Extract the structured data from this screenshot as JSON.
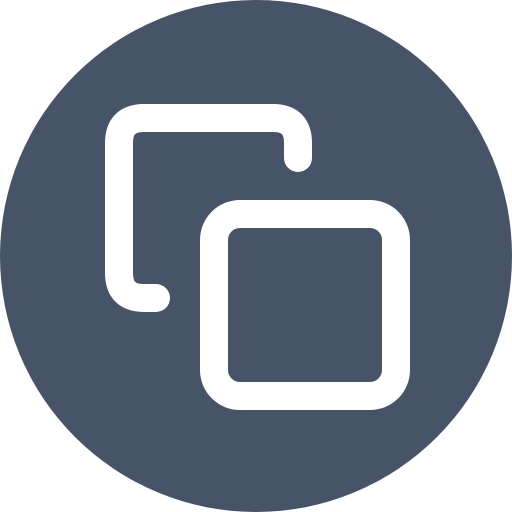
{
  "icon": {
    "name": "copy-icon",
    "background_color": "#475467",
    "foreground_color": "#ffffff"
  }
}
